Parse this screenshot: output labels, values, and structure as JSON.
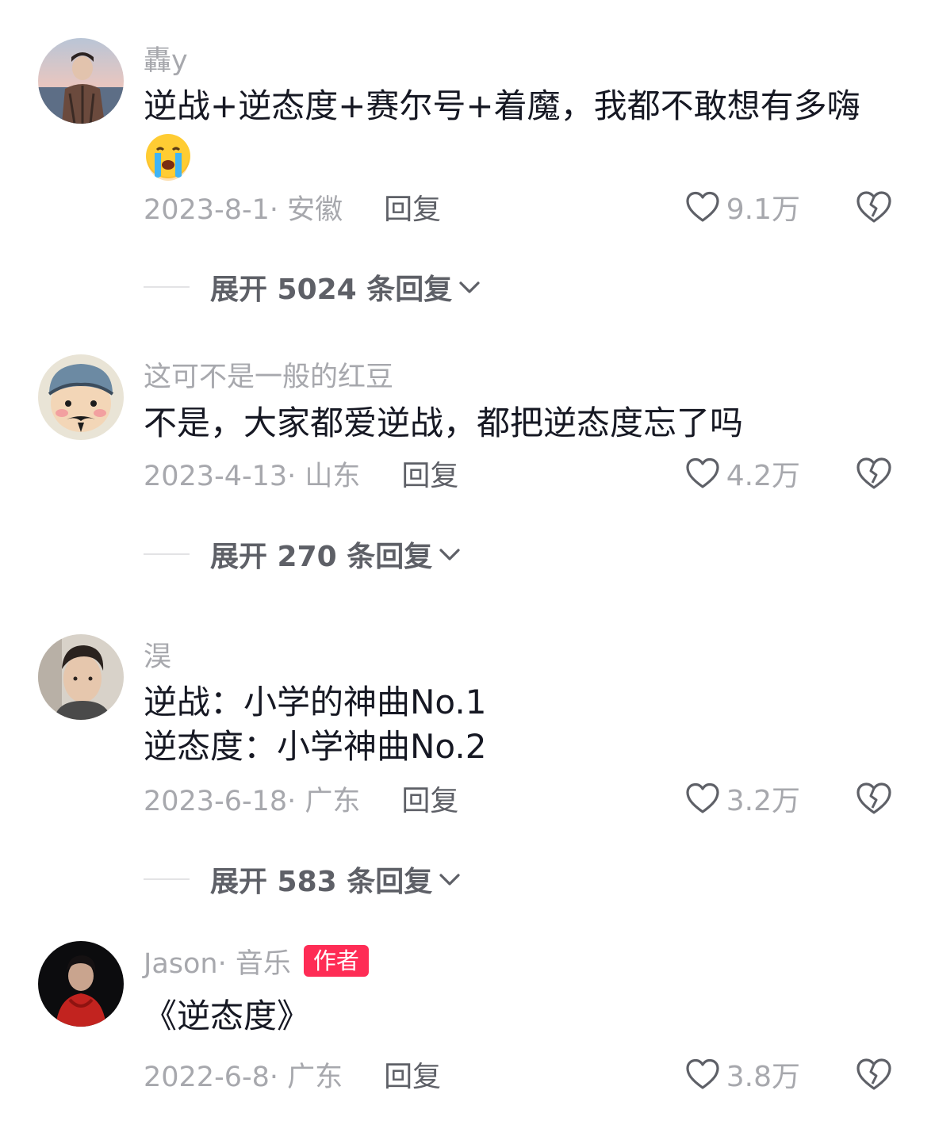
{
  "comments": [
    {
      "username": "轟y",
      "content": "逆战+逆态度+赛尔号+着魔，我都不敢想有多嗨",
      "emoji": "crying-face",
      "meta": "2023-8-1· 安徽",
      "reply_label": "回复",
      "likes": "9.1万",
      "expand_label": "展开 5024 条回复"
    },
    {
      "username": "这可不是一般的红豆",
      "content": "不是，大家都爱逆战，都把逆态度忘了吗",
      "meta": "2023-4-13· 山东",
      "reply_label": "回复",
      "likes": "4.2万",
      "expand_label": "展开 270 条回复"
    },
    {
      "username": "淏",
      "content": "逆战：小学的神曲No.1\n逆态度：小学神曲No.2",
      "meta": "2023-6-18· 广东",
      "reply_label": "回复",
      "likes": "3.2万",
      "expand_label": "展开 583 条回复"
    },
    {
      "username": "Jason· 音乐",
      "badge": "作者",
      "content": "《逆态度》",
      "meta": "2022-6-8· 广东",
      "reply_label": "回复",
      "likes": "3.8万"
    }
  ],
  "icons": {
    "like": "heart-outline-icon",
    "dislike": "broken-heart-icon",
    "expand": "chevron-down-icon"
  },
  "colors": {
    "badge": "#fe2c55",
    "muted": "#a7a8ad",
    "text": "#161823"
  }
}
